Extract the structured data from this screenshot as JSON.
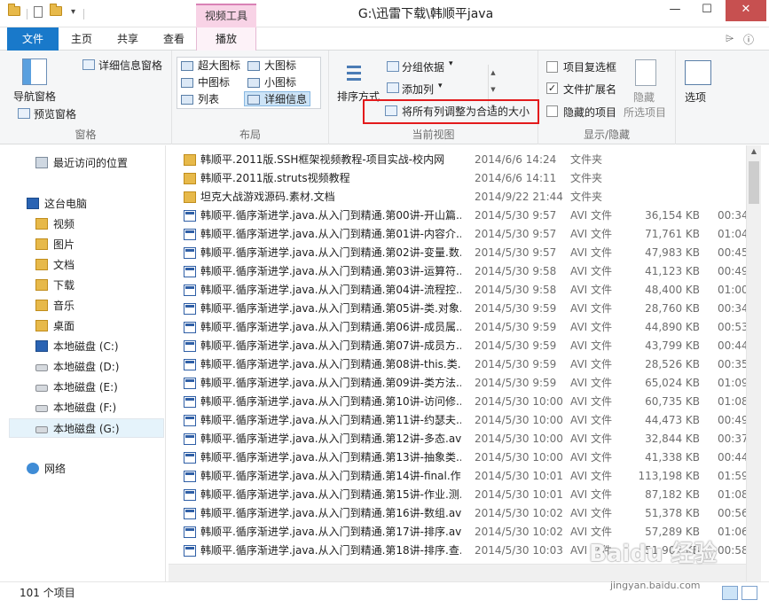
{
  "window": {
    "title": "G:\\迅雷下载\\韩顺平java",
    "context_tab_header": "视频工具",
    "minimize": "—",
    "maximize": "☐",
    "close": "✕"
  },
  "tabs": [
    {
      "label": "文件"
    },
    {
      "label": "主页"
    },
    {
      "label": "共享"
    },
    {
      "label": "查看"
    },
    {
      "label": "播放"
    }
  ],
  "ribbon": {
    "panes": {
      "label": "窗格",
      "nav_pane": "导航窗格",
      "preview_pane": "预览窗格",
      "details_pane": "详细信息窗格"
    },
    "layout": {
      "label": "布局",
      "items": [
        {
          "label": "超大图标"
        },
        {
          "label": "大图标"
        },
        {
          "label": "中图标"
        },
        {
          "label": "小图标"
        },
        {
          "label": "列表"
        },
        {
          "label": "详细信息"
        }
      ]
    },
    "current_view": {
      "label": "当前视图",
      "sort_by": "排序方式",
      "group_by": "分组依据",
      "add_column": "添加列",
      "fit_columns": "将所有列调整为合适的大小"
    },
    "show_hide": {
      "label": "显示/隐藏",
      "item_checkboxes": "项目复选框",
      "file_extensions": "文件扩展名",
      "hidden_items": "隐藏的项目",
      "hide": "隐藏",
      "selected_items": "所选项目"
    },
    "options": "选项"
  },
  "nav": {
    "items": [
      {
        "label": "最近访问的位置"
      },
      {
        "label": "这台电脑"
      },
      {
        "label": "视频"
      },
      {
        "label": "图片"
      },
      {
        "label": "文档"
      },
      {
        "label": "下载"
      },
      {
        "label": "音乐"
      },
      {
        "label": "桌面"
      },
      {
        "label": "本地磁盘 (C:)"
      },
      {
        "label": "本地磁盘 (D:)"
      },
      {
        "label": "本地磁盘 (E:)"
      },
      {
        "label": "本地磁盘 (F:)"
      },
      {
        "label": "本地磁盘 (G:)"
      },
      {
        "label": "网络"
      }
    ]
  },
  "files": [
    {
      "name": "韩顺平.2011版.SSH框架视频教程-项目实战-校内网",
      "date": "2014/6/6 14:24",
      "type": "文件夹",
      "size": "",
      "dur": "",
      "kind": "folder"
    },
    {
      "name": "韩顺平.2011版.struts视频教程",
      "date": "2014/6/6 14:11",
      "type": "文件夹",
      "size": "",
      "dur": "",
      "kind": "folder"
    },
    {
      "name": "坦克大战游戏源码.素材.文档",
      "date": "2014/9/22 21:44",
      "type": "文件夹",
      "size": "",
      "dur": "",
      "kind": "folder"
    },
    {
      "name": "韩顺平.循序渐进学.java.从入门到精通.第00讲-开山篇...",
      "date": "2014/5/30 9:57",
      "type": "AVI 文件",
      "size": "36,154 KB",
      "dur": "00:34:",
      "kind": "avi"
    },
    {
      "name": "韩顺平.循序渐进学.java.从入门到精通.第01讲-内容介...",
      "date": "2014/5/30 9:57",
      "type": "AVI 文件",
      "size": "71,761 KB",
      "dur": "01:04:",
      "kind": "avi"
    },
    {
      "name": "韩顺平.循序渐进学.java.从入门到精通.第02讲-变量.数...",
      "date": "2014/5/30 9:57",
      "type": "AVI 文件",
      "size": "47,983 KB",
      "dur": "00:45:",
      "kind": "avi"
    },
    {
      "name": "韩顺平.循序渐进学.java.从入门到精通.第03讲-运算符...",
      "date": "2014/5/30 9:58",
      "type": "AVI 文件",
      "size": "41,123 KB",
      "dur": "00:49:",
      "kind": "avi"
    },
    {
      "name": "韩顺平.循序渐进学.java.从入门到精通.第04讲-流程控...",
      "date": "2014/5/30 9:58",
      "type": "AVI 文件",
      "size": "48,400 KB",
      "dur": "01:00:",
      "kind": "avi"
    },
    {
      "name": "韩顺平.循序渐进学.java.从入门到精通.第05讲-类.对象...",
      "date": "2014/5/30 9:59",
      "type": "AVI 文件",
      "size": "28,760 KB",
      "dur": "00:34:",
      "kind": "avi"
    },
    {
      "name": "韩顺平.循序渐进学.java.从入门到精通.第06讲-成员属...",
      "date": "2014/5/30 9:59",
      "type": "AVI 文件",
      "size": "44,890 KB",
      "dur": "00:53:",
      "kind": "avi"
    },
    {
      "name": "韩顺平.循序渐进学.java.从入门到精通.第07讲-成员方...",
      "date": "2014/5/30 9:59",
      "type": "AVI 文件",
      "size": "43,799 KB",
      "dur": "00:44:",
      "kind": "avi"
    },
    {
      "name": "韩顺平.循序渐进学.java.从入门到精通.第08讲-this.类...",
      "date": "2014/5/30 9:59",
      "type": "AVI 文件",
      "size": "28,526 KB",
      "dur": "00:35:",
      "kind": "avi"
    },
    {
      "name": "韩顺平.循序渐进学.java.从入门到精通.第09讲-类方法...",
      "date": "2014/5/30 9:59",
      "type": "AVI 文件",
      "size": "65,024 KB",
      "dur": "01:09:",
      "kind": "avi"
    },
    {
      "name": "韩顺平.循序渐进学.java.从入门到精通.第10讲-访问修...",
      "date": "2014/5/30 10:00",
      "type": "AVI 文件",
      "size": "60,735 KB",
      "dur": "01:08:",
      "kind": "avi"
    },
    {
      "name": "韩顺平.循序渐进学.java.从入门到精通.第11讲-约瑟夫...",
      "date": "2014/5/30 10:00",
      "type": "AVI 文件",
      "size": "44,473 KB",
      "dur": "00:49:",
      "kind": "avi"
    },
    {
      "name": "韩顺平.循序渐进学.java.从入门到精通.第12讲-多态.avi",
      "date": "2014/5/30 10:00",
      "type": "AVI 文件",
      "size": "32,844 KB",
      "dur": "00:37:",
      "kind": "avi"
    },
    {
      "name": "韩顺平.循序渐进学.java.从入门到精通.第13讲-抽象类...",
      "date": "2014/5/30 10:00",
      "type": "AVI 文件",
      "size": "41,338 KB",
      "dur": "00:44:",
      "kind": "avi"
    },
    {
      "name": "韩顺平.循序渐进学.java.从入门到精通.第14讲-final.作...",
      "date": "2014/5/30 10:01",
      "type": "AVI 文件",
      "size": "113,198 KB",
      "dur": "01:59:",
      "kind": "avi"
    },
    {
      "name": "韩顺平.循序渐进学.java.从入门到精通.第15讲-作业.测...",
      "date": "2014/5/30 10:01",
      "type": "AVI 文件",
      "size": "87,182 KB",
      "dur": "01:08:",
      "kind": "avi"
    },
    {
      "name": "韩顺平.循序渐进学.java.从入门到精通.第16讲-数组.avi",
      "date": "2014/5/30 10:02",
      "type": "AVI 文件",
      "size": "51,378 KB",
      "dur": "00:56:",
      "kind": "avi"
    },
    {
      "name": "韩顺平.循序渐进学.java.从入门到精通.第17讲-排序.avi",
      "date": "2014/5/30 10:02",
      "type": "AVI 文件",
      "size": "57,289 KB",
      "dur": "01:06:",
      "kind": "avi"
    },
    {
      "name": "韩顺平.循序渐进学.java.从入门到精通.第18讲-排序.查...",
      "date": "2014/5/30 10:03",
      "type": "AVI 文件",
      "size": "51,904 KB",
      "dur": "00:58:",
      "kind": "avi"
    }
  ],
  "status": {
    "item_count": "101 个项目"
  },
  "watermark": {
    "logo": "Baidu 经验",
    "url": "jingyan.baidu.com"
  },
  "colors": {
    "file_tab": "#1979ca",
    "context_tab": "#f8d3e6",
    "highlight": "#e31a1c",
    "selected": "#cde4f7"
  }
}
